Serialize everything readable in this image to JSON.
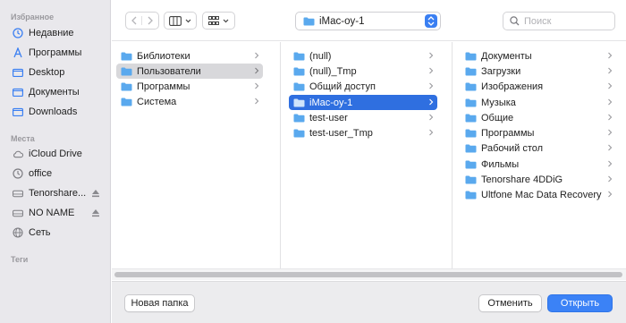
{
  "sidebar": {
    "favorites_title": "Избранное",
    "favorites": [
      {
        "label": "Недавние",
        "icon": "clock-icon"
      },
      {
        "label": "Программы",
        "icon": "apps-icon"
      },
      {
        "label": "Desktop",
        "icon": "desktop-folder-icon"
      },
      {
        "label": "Документы",
        "icon": "documents-folder-icon"
      },
      {
        "label": "Downloads",
        "icon": "downloads-folder-icon"
      }
    ],
    "locations_title": "Места",
    "locations": [
      {
        "label": "iCloud Drive",
        "icon": "cloud-icon"
      },
      {
        "label": "office",
        "icon": "clock-icon"
      },
      {
        "label": "Tenorshare...",
        "icon": "drive-icon",
        "eject": true
      },
      {
        "label": "NO NAME",
        "icon": "drive-icon",
        "eject": true
      },
      {
        "label": "Сеть",
        "icon": "network-icon"
      }
    ],
    "tags_title": "Теги"
  },
  "toolbar": {
    "back_icon": "chevron-left-icon",
    "forward_icon": "chevron-right-icon",
    "view_icon": "column-view-icon",
    "group_icon": "grid-view-icon",
    "path_label": "iMac-oy-1",
    "search_placeholder": "Поиск"
  },
  "columns": [
    {
      "items": [
        {
          "label": "Библиотеки",
          "state": "none"
        },
        {
          "label": "Пользователи",
          "state": "grey"
        },
        {
          "label": "Программы",
          "state": "none"
        },
        {
          "label": "Система",
          "state": "none"
        }
      ]
    },
    {
      "items": [
        {
          "label": "(null)",
          "state": "none"
        },
        {
          "label": "(null)_Tmp",
          "state": "none"
        },
        {
          "label": "Общий доступ",
          "state": "none"
        },
        {
          "label": "iMac-oy-1",
          "state": "blue"
        },
        {
          "label": "test-user",
          "state": "none"
        },
        {
          "label": "test-user_Tmp",
          "state": "none"
        }
      ]
    },
    {
      "items": [
        {
          "label": "Документы",
          "state": "none"
        },
        {
          "label": "Загрузки",
          "state": "none"
        },
        {
          "label": "Изображения",
          "state": "none"
        },
        {
          "label": "Музыка",
          "state": "none"
        },
        {
          "label": "Общие",
          "state": "none"
        },
        {
          "label": "Программы",
          "state": "none"
        },
        {
          "label": "Рабочий стол",
          "state": "none"
        },
        {
          "label": "Фильмы",
          "state": "none"
        },
        {
          "label": "Tenorshare 4DDiG",
          "state": "none"
        },
        {
          "label": "Ultfone Mac Data Recovery",
          "state": "none"
        }
      ]
    }
  ],
  "bottom": {
    "new_folder": "Новая папка",
    "cancel": "Отменить",
    "open": "Открыть"
  },
  "colors": {
    "accent": "#3b82f6",
    "folder": "#5aa9ee",
    "sidebar_icon": "#3a7ff2"
  }
}
